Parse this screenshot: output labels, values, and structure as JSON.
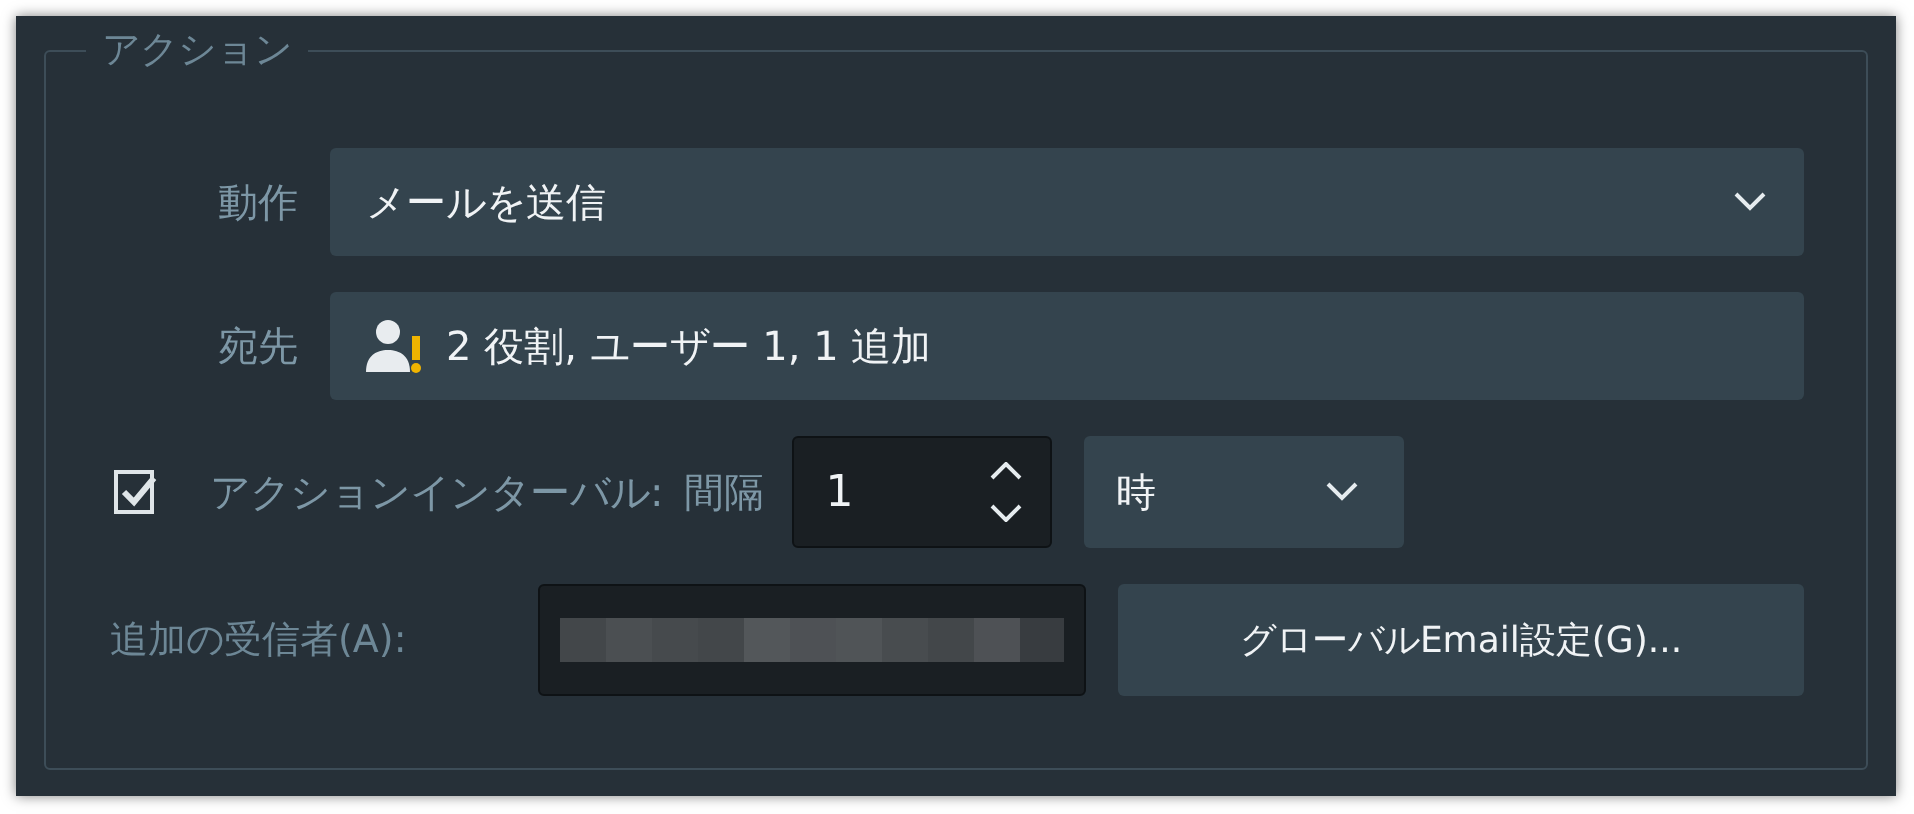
{
  "group": {
    "title": "アクション"
  },
  "action": {
    "label": "動作",
    "value": "メールを送信"
  },
  "recipients": {
    "label": "宛先",
    "value": "2 役割, ユーザー 1, 1 追加",
    "warning": true
  },
  "interval": {
    "checked": true,
    "label": "アクションインターバル:",
    "sublabel": "間隔",
    "value": "1",
    "unit": "時"
  },
  "additional": {
    "label": "追加の受信者(A):",
    "button": "グローバルEmail設定(G)..."
  }
}
